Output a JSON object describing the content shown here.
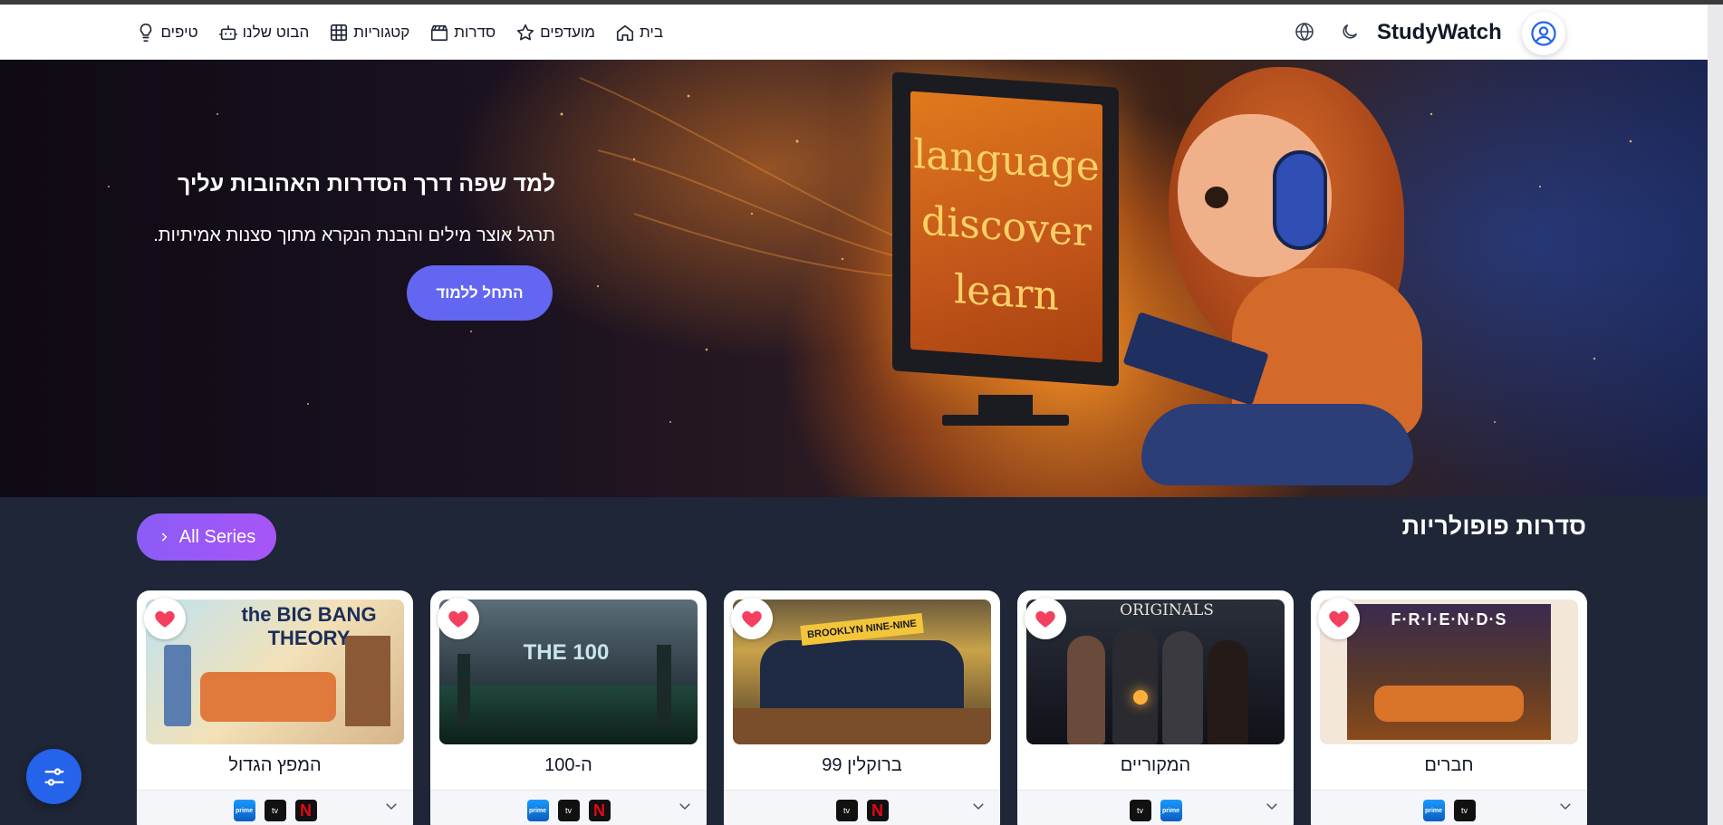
{
  "brand": {
    "name": "StudyWatch"
  },
  "nav": {
    "items": [
      {
        "label": "בית",
        "icon": "home-icon"
      },
      {
        "label": "מועדפים",
        "icon": "star-icon"
      },
      {
        "label": "סדרות",
        "icon": "clapperboard-icon"
      },
      {
        "label": "קטגוריות",
        "icon": "grid-icon"
      },
      {
        "label": "הבוט שלנו",
        "icon": "bot-icon"
      },
      {
        "label": "טיפים",
        "icon": "lightbulb-icon"
      }
    ],
    "language_icon": "globe-icon",
    "theme_icon": "moon-icon",
    "profile_icon": "user-circle-icon"
  },
  "hero": {
    "title": "למד שפה דרך הסדרות האהובות עליך",
    "subtitle": "תרגל אוצר מילים והבנת הנקרא מתוך סצנות אמיתיות.",
    "cta_label": "התחל ללמוד",
    "screen_words": [
      "language",
      "discover",
      "learn"
    ]
  },
  "popular": {
    "title": "סדרות פופולריות",
    "all_series_label": "All Series",
    "cards": [
      {
        "title": "חברים",
        "image_text": "F·R·I·E·N·D·S",
        "platforms": [
          "appletv",
          "prime"
        ],
        "favorite": true
      },
      {
        "title": "המקוריים",
        "image_text": "ORIGINALS",
        "platforms": [
          "appletv",
          "prime"
        ],
        "favorite": true
      },
      {
        "title": "ברוקלין 99",
        "image_text": "BROOKLYN NINE-NINE",
        "platforms": [
          "appletv",
          "netflix"
        ],
        "favorite": true
      },
      {
        "title": "ה-100",
        "image_text": "THE 100",
        "platforms": [
          "prime",
          "appletv",
          "netflix"
        ],
        "favorite": true
      },
      {
        "title": "המפץ הגדול",
        "image_text": "the BIG BANG THEORY",
        "platforms": [
          "prime",
          "appletv",
          "netflix"
        ],
        "favorite": true
      }
    ]
  },
  "platform_labels": {
    "appletv": "tv",
    "prime": "prime",
    "netflix": "N"
  },
  "colors": {
    "primary": "#6366f1",
    "accent": "#a855f7",
    "fab": "#2563eb",
    "heart": "#f43f5e",
    "section_bg": "#1e2637"
  }
}
